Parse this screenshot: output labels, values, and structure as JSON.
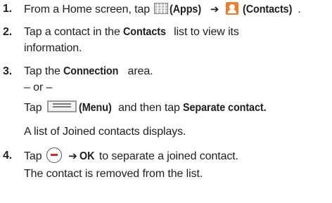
{
  "steps": [
    {
      "number": "1.",
      "prefix": "From a Home screen, tap",
      "apps_label": "(Apps)",
      "arrow": "➔",
      "contacts_label": "(Contacts)",
      "period": "."
    },
    {
      "number": "2.",
      "line1_pre": "Tap a contact in the",
      "line1_bold": "Contacts",
      "line1_post": "list to view its",
      "line2": "information."
    },
    {
      "number": "3.",
      "line1_pre": "Tap the",
      "line1_bold": "Connection",
      "line1_post": "area.",
      "or_text": "– or –",
      "alt_pre": "Tap",
      "menu_label": "(Menu)",
      "alt_mid": "and then tap",
      "alt_bold": "Separate contact.",
      "result": "A list of Joined contacts displays."
    },
    {
      "number": "4.",
      "pre": "Tap",
      "arrow": "➔",
      "ok": "OK",
      "post": "to separate a joined contact.",
      "result": "The contact is removed from the list."
    }
  ],
  "icons": {
    "apps": "apps-grid-icon",
    "contacts": "contacts-icon",
    "menu": "menu-key-icon",
    "remove": "remove-minus-icon"
  },
  "colors": {
    "contacts_icon": "#f07e28",
    "remove_minus": "#e3262c"
  }
}
